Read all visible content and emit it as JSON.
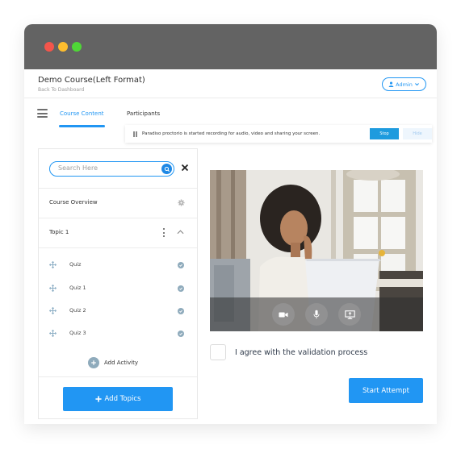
{
  "window": {
    "controls": [
      "close",
      "minimize",
      "maximize"
    ]
  },
  "header": {
    "title": "Demo Course(Left Format)",
    "back_link": "Back To Dashboard",
    "user_menu": {
      "label": "Admin",
      "icon": "user-icon",
      "chevron": "chevron-down-icon"
    }
  },
  "nav": {
    "menu_icon": "hamburger-icon",
    "tabs": [
      {
        "label": "Course Content",
        "active": true
      },
      {
        "label": "Participants",
        "active": false
      }
    ]
  },
  "notice": {
    "icon": "pause-icon",
    "text": "Paradiso proctorio is started recording for audio, video and sharing your screen.",
    "stop_label": "Stop",
    "hide_label": "Hide"
  },
  "sidebar": {
    "search": {
      "placeholder": "Search Here",
      "value": ""
    },
    "overview_label": "Course Overview",
    "topic": {
      "label": "Topic 1",
      "expanded": true
    },
    "activities": [
      {
        "label": "Quiz",
        "completed": true
      },
      {
        "label": "Quiz 1",
        "completed": true
      },
      {
        "label": "Quiz 2",
        "completed": true
      },
      {
        "label": "Quiz 3",
        "completed": true
      }
    ],
    "add_activity_label": "Add Activity",
    "add_topics_label": "Add Topics"
  },
  "main": {
    "video_controls": [
      "camera-icon",
      "microphone-icon",
      "screen-share-icon"
    ],
    "agree_label": "I agree with the validation process",
    "agree_checked": false,
    "start_label": "Start Attempt"
  },
  "colors": {
    "accent": "#2196f3",
    "titlebar": "#636363",
    "activity_icon": "#8fabbc"
  }
}
